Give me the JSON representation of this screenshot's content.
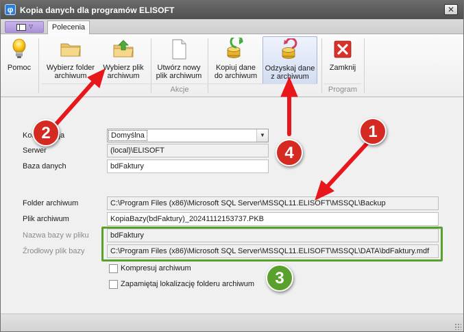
{
  "window": {
    "title": "Kopia danych dla programów ELISOFT",
    "close_glyph": "✕"
  },
  "tabs": [
    {
      "label": "Polecenia"
    }
  ],
  "ribbon": {
    "buttons": [
      {
        "label": "Pomoc",
        "icon": "lightbulb-icon"
      },
      {
        "label": "Wybierz folder\narchiwum",
        "icon": "folder-icon"
      },
      {
        "label": "Wybierz plik\narchiwum",
        "icon": "folder-up-icon"
      },
      {
        "label": "Utwórz nowy\nplik archiwum",
        "icon": "new-file-icon"
      },
      {
        "label": "Kopiuj dane\ndo archiwum",
        "icon": "database-copy-icon"
      },
      {
        "label": "Odzyskaj dane\nz archiwum",
        "icon": "database-restore-icon"
      },
      {
        "label": "Zamknij",
        "icon": "close-red-icon"
      }
    ],
    "groups": [
      {
        "label": "Akcje"
      },
      {
        "label": "Program"
      }
    ]
  },
  "form": {
    "konfiguracja_label": "Konfiguracja",
    "konfiguracja_value": "Domyślna",
    "serwer_label": "Serwer",
    "serwer_value": "(local)\\ELISOFT",
    "baza_label": "Baza danych",
    "baza_value": "bdFaktury",
    "folder_label": "Folder archiwum",
    "folder_value": "C:\\Program Files (x86)\\Microsoft SQL Server\\MSSQL11.ELISOFT\\MSSQL\\Backup",
    "plik_label": "Plik archiwum",
    "plik_value": "KopiaBazy(bdFaktury)_20241112153737.PKB",
    "nazwa_label": "Nazwa bazy w pliku",
    "nazwa_value": "bdFaktury",
    "zrodlowy_label": "Źrodłowy plik bazy",
    "zrodlowy_value": "C:\\Program Files (x86)\\Microsoft SQL Server\\MSSQL11.ELISOFT\\MSSQL\\DATA\\bdFaktury.mdf",
    "kompresuj_label": "Kompresuj archiwum",
    "zapamietaj_label": "Zapamiętaj lokalizację folderu archiwum"
  },
  "annotations": {
    "badges": [
      "1",
      "2",
      "3",
      "4"
    ],
    "colors": {
      "red": "#d42a22",
      "green": "#5aa02c",
      "arrow": "#e8171b"
    }
  }
}
